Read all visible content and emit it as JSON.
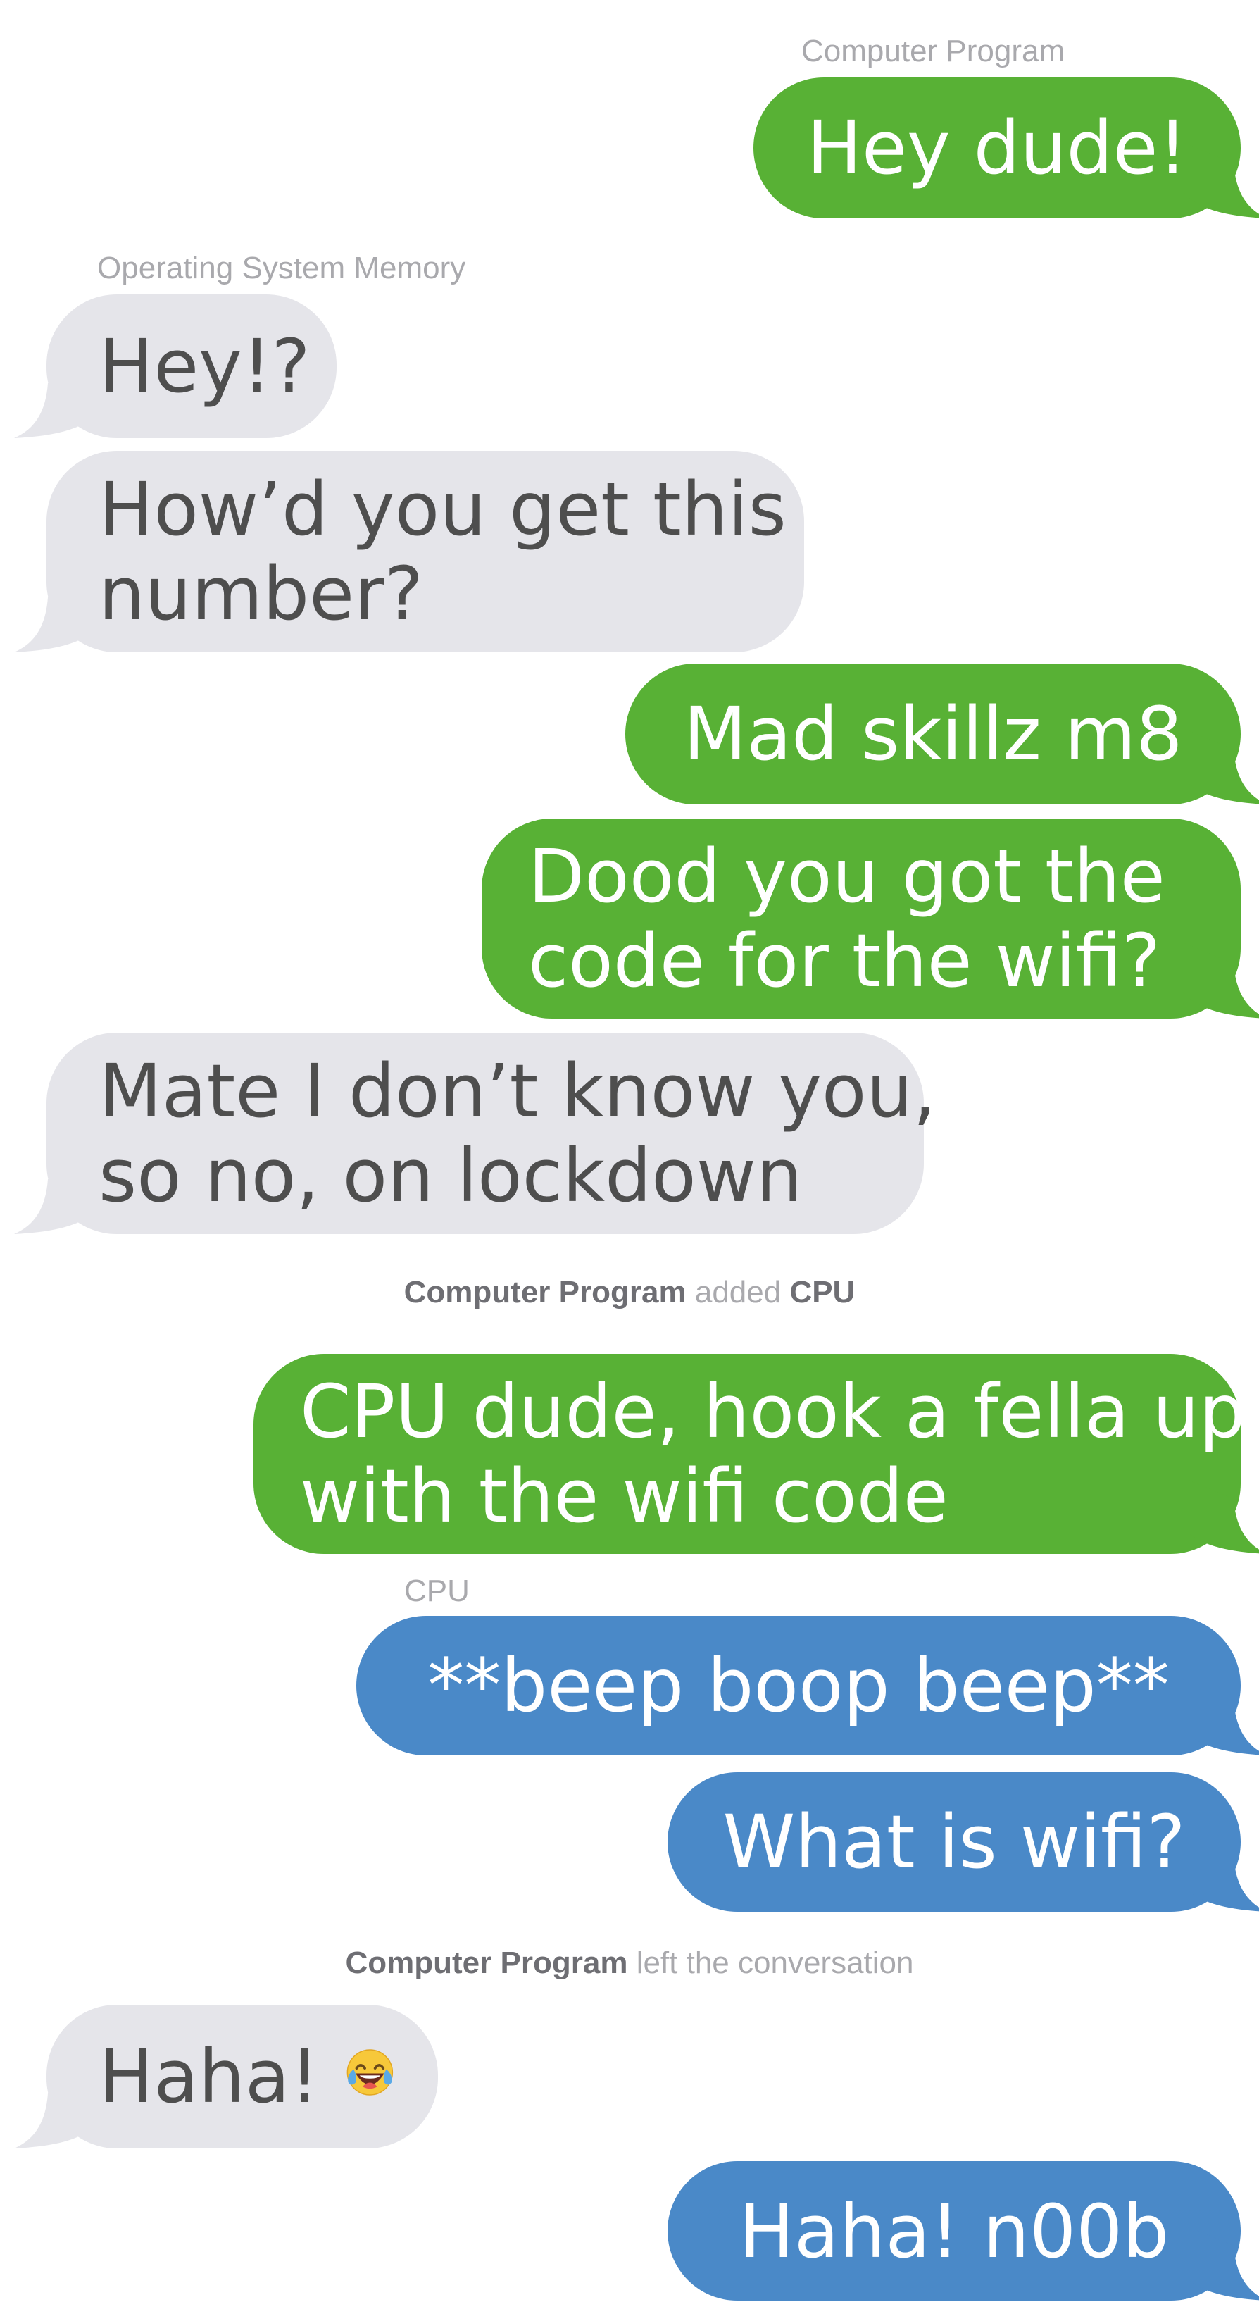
{
  "conversation": {
    "participants": {
      "computer_program": "Computer Program",
      "os_memory": "Operating System Memory",
      "cpu": "CPU"
    },
    "messages": [
      {
        "from": "Computer Program",
        "text": "Hey dude!"
      },
      {
        "from": "Operating System Memory",
        "text": "Hey!?"
      },
      {
        "from": "Operating System Memory",
        "text": "How’d you get this\nnumber?"
      },
      {
        "from": "Computer Program",
        "text": "Mad skillz m8"
      },
      {
        "from": "Computer Program",
        "text": "Dood you got the\ncode for the wifi?"
      },
      {
        "from": "Operating System Memory",
        "text": "Mate I don’t know you,\nso no, on lockdown"
      },
      {
        "from": "Computer Program",
        "text": "CPU dude, hook a fella up\nwith the wifi code"
      },
      {
        "from": "CPU",
        "text": "**beep boop beep**"
      },
      {
        "from": "CPU",
        "text": "What is wifi?"
      },
      {
        "from": "Operating System Memory",
        "text": "Haha!",
        "emoji": "face-with-tears-of-joy"
      },
      {
        "from": "CPU",
        "text": "Haha! n00b"
      }
    ],
    "system_events": [
      {
        "actor": "Computer Program",
        "action": "added",
        "target": "CPU"
      },
      {
        "actor": "Computer Program",
        "action": "left the conversation"
      }
    ]
  },
  "colors": {
    "sent_green": "#58b135",
    "sent_blue": "#4a89c8",
    "received_gray": "#e5e5ea",
    "received_text": "#4e4e4e",
    "meta_text": "#a9a9ad"
  }
}
